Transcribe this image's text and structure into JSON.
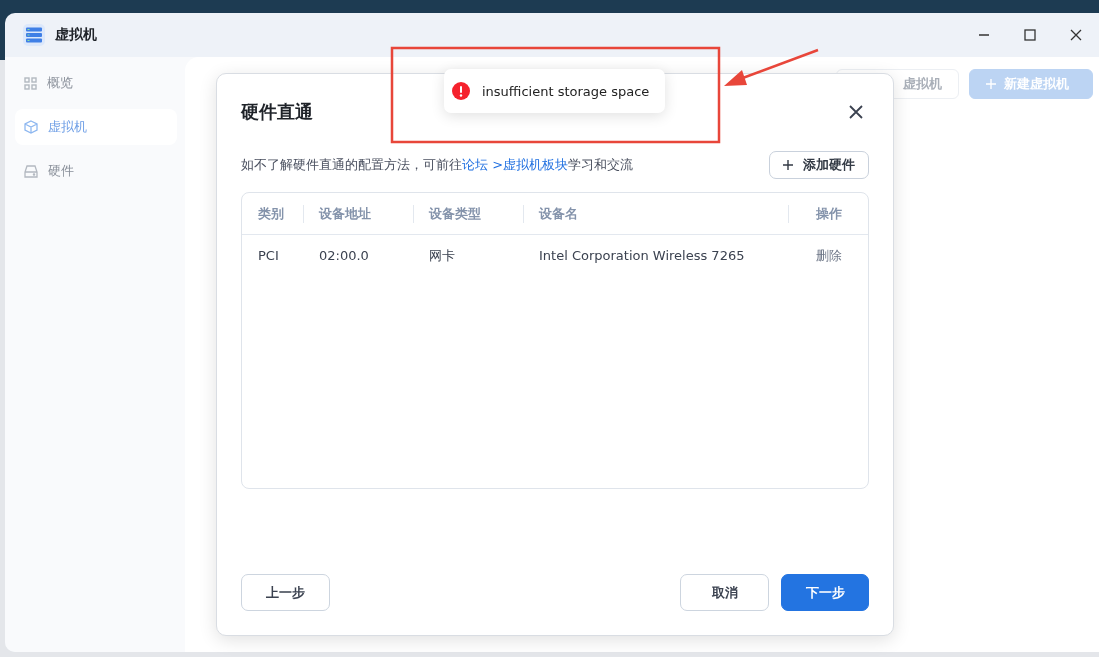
{
  "window": {
    "title": "虚拟机"
  },
  "sidebar": {
    "items": [
      {
        "label": "概览",
        "kind": "grid",
        "selected": false
      },
      {
        "label": "虚拟机",
        "kind": "cube",
        "selected": true
      },
      {
        "label": "硬件",
        "kind": "drive",
        "selected": false
      }
    ]
  },
  "content": {
    "buttons": [
      {
        "label": "虚拟机",
        "kind": "outline"
      },
      {
        "label": "新建虚拟机",
        "kind": "primary"
      }
    ]
  },
  "dialog": {
    "title": "硬件直通",
    "notice": [
      {
        "kind": "text",
        "text": "如不了解硬件直通的配置方法，可前往"
      },
      {
        "kind": "link",
        "text": "论坛"
      },
      {
        "kind": "link",
        "text": " >虚拟机板块"
      },
      {
        "kind": "text",
        "text": "学习和交流"
      }
    ],
    "add_button": "添加硬件",
    "table": {
      "columns": [
        "类别",
        "设备地址",
        "设备类型",
        "设备名",
        "操作"
      ],
      "rows": [
        {
          "cells": [
            "PCI",
            "02:00.0",
            "网卡",
            "Intel Corporation Wireless 7265"
          ],
          "action": "删除"
        }
      ]
    },
    "footer": {
      "left": [
        {
          "label": "上一步",
          "kind": "secondary"
        }
      ],
      "right": [
        {
          "label": "取消",
          "kind": "secondary"
        },
        {
          "label": "下一步",
          "kind": "primary"
        }
      ]
    }
  },
  "toast": {
    "kind": "error",
    "message": "insufficient storage space"
  }
}
